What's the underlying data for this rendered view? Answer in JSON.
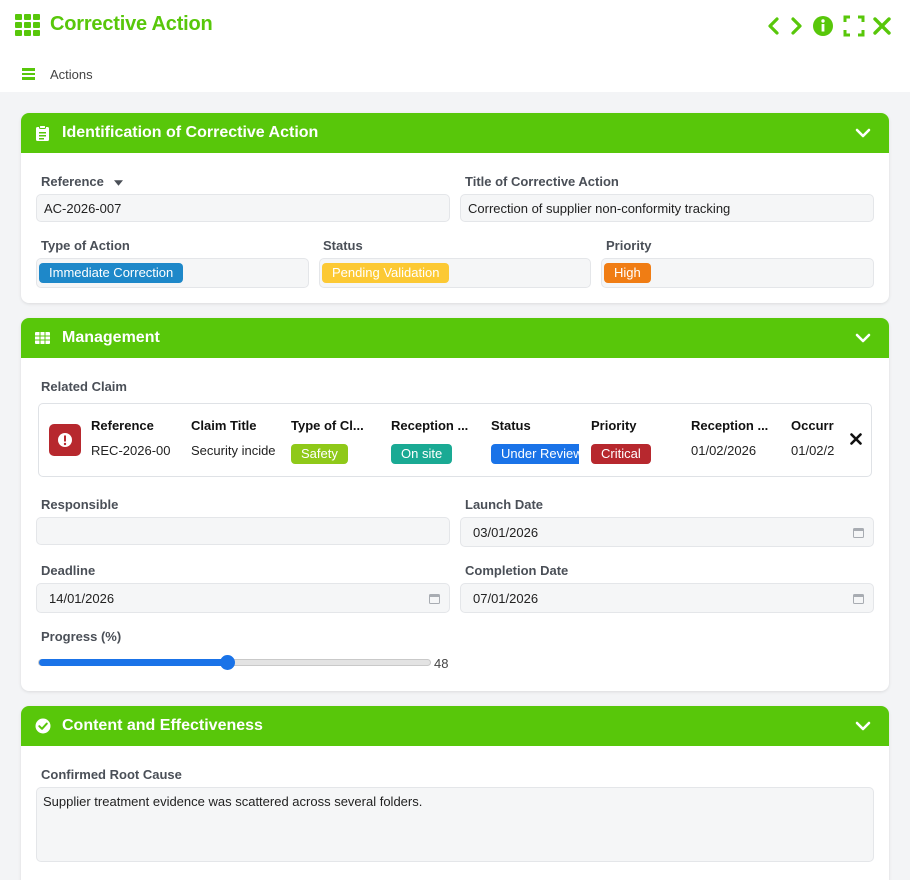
{
  "app": {
    "title": "Corrective Action",
    "actions_label": "Actions",
    "accent_color": "#58c70a",
    "icons": [
      "grid-icon",
      "prev-icon",
      "next-icon",
      "info-icon",
      "expand-icon",
      "close-icon",
      "hamburger-icon"
    ]
  },
  "identification": {
    "title": "Identification of Corrective Action",
    "icon": "clipboard-icon",
    "reference_label": "Reference",
    "reference_value": "AC-2026-007",
    "title_label": "Title of Corrective Action",
    "title_value": "Correction of supplier non-conformity tracking",
    "type_label": "Type of Action",
    "type_value": "Immediate Correction",
    "type_color": "#1e88c9",
    "status_label": "Status",
    "status_value": "Pending Validation",
    "status_color": "#fcc934",
    "priority_label": "Priority",
    "priority_value": "High",
    "priority_color": "#f07d14"
  },
  "management": {
    "title": "Management",
    "icon": "table-icon",
    "related_claim_label": "Related Claim",
    "claim": {
      "headers": [
        "Reference",
        "Claim Title",
        "Type of Cl...",
        "Reception ...",
        "Status",
        "Priority",
        "Reception ...",
        "Occurr"
      ],
      "reference": "REC-2026-00",
      "claim_title": "Security incide",
      "type": "Safety",
      "type_color": "#8fc919",
      "reception_mode": "On site",
      "reception_color": "#1aaa94",
      "status": "Under Review",
      "status_color": "#1a73e8",
      "priority": "Critical",
      "priority_color": "#b7282e",
      "reception_date": "01/02/2026",
      "occurrence_date": "01/02/2"
    },
    "responsible_label": "Responsible",
    "responsible_value": "",
    "launch_label": "Launch Date",
    "launch_value": "03/01/2026",
    "deadline_label": "Deadline",
    "deadline_value": "14/01/2026",
    "completion_label": "Completion Date",
    "completion_value": "07/01/2026",
    "progress_label": "Progress (%)",
    "progress_value": 48,
    "progress_text": "48"
  },
  "content": {
    "title": "Content and Effectiveness",
    "icon": "check-circle-icon",
    "root_cause_label": "Confirmed Root Cause",
    "root_cause_value": "Supplier treatment evidence was scattered across several folders."
  }
}
